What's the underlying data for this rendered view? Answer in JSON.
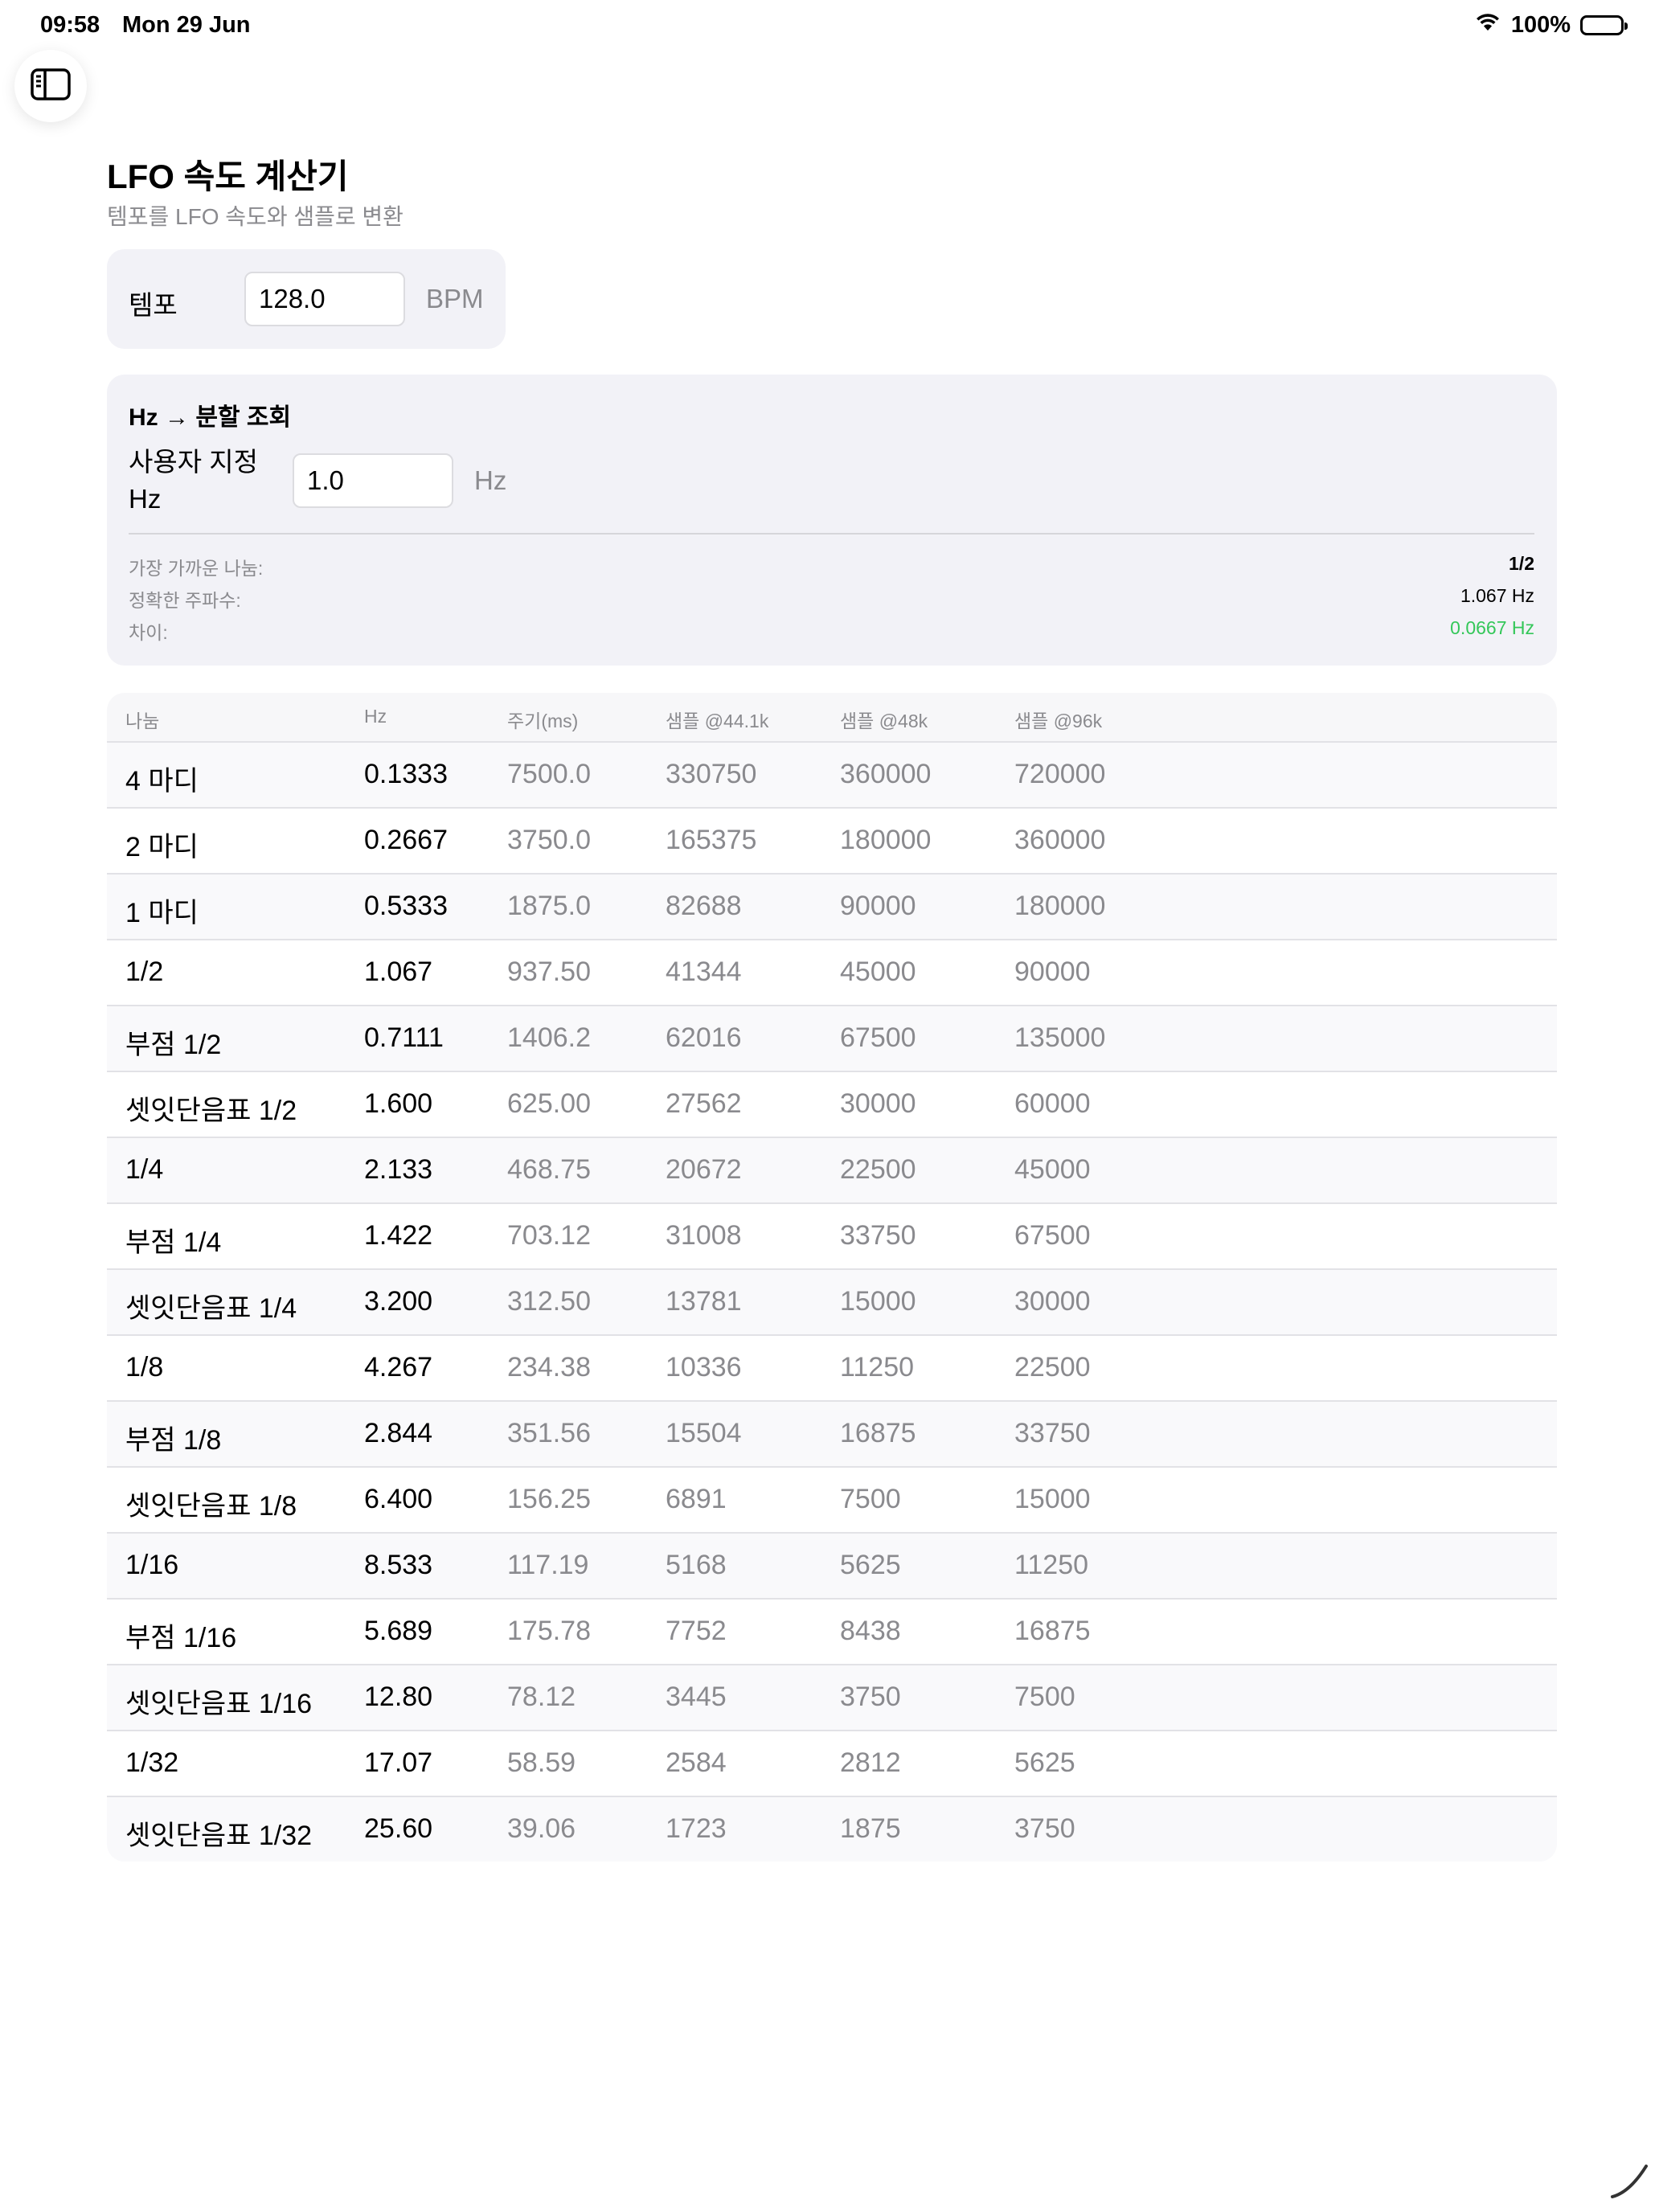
{
  "status": {
    "time": "09:58",
    "date": "Mon 29 Jun",
    "battery": "100%"
  },
  "colors": {
    "accent_green": "#34c759",
    "secondary_text": "#8a8a8e",
    "card_bg": "#f2f2f7"
  },
  "header": {
    "title": "LFO 속도 계산기",
    "subtitle": "템포를 LFO 속도와 샘플로 변환"
  },
  "tempo": {
    "label": "템포",
    "value": "128.0",
    "unit": "BPM"
  },
  "lookup": {
    "heading": "Hz → 분할 조회",
    "custom_label": "사용자 지정 Hz",
    "value": "1.0",
    "unit": "Hz",
    "nearest_label": "가장 가까운 나눔:",
    "nearest_value": "1/2",
    "exact_label": "정확한 주파수:",
    "exact_value": "1.067 Hz",
    "diff_label": "차이:",
    "diff_value": "0.0667 Hz"
  },
  "table": {
    "headers": [
      "나눔",
      "Hz",
      "주기(ms)",
      "샘플 @44.1k",
      "샘플 @48k",
      "샘플 @96k"
    ],
    "rows": [
      [
        "4 마디",
        "0.1333",
        "7500.0",
        "330750",
        "360000",
        "720000"
      ],
      [
        "2 마디",
        "0.2667",
        "3750.0",
        "165375",
        "180000",
        "360000"
      ],
      [
        "1 마디",
        "0.5333",
        "1875.0",
        "82688",
        "90000",
        "180000"
      ],
      [
        "1/2",
        "1.067",
        "937.50",
        "41344",
        "45000",
        "90000"
      ],
      [
        "부점 1/2",
        "0.7111",
        "1406.2",
        "62016",
        "67500",
        "135000"
      ],
      [
        "셋잇단음표 1/2",
        "1.600",
        "625.00",
        "27562",
        "30000",
        "60000"
      ],
      [
        "1/4",
        "2.133",
        "468.75",
        "20672",
        "22500",
        "45000"
      ],
      [
        "부점 1/4",
        "1.422",
        "703.12",
        "31008",
        "33750",
        "67500"
      ],
      [
        "셋잇단음표 1/4",
        "3.200",
        "312.50",
        "13781",
        "15000",
        "30000"
      ],
      [
        "1/8",
        "4.267",
        "234.38",
        "10336",
        "11250",
        "22500"
      ],
      [
        "부점 1/8",
        "2.844",
        "351.56",
        "15504",
        "16875",
        "33750"
      ],
      [
        "셋잇단음표 1/8",
        "6.400",
        "156.25",
        "6891",
        "7500",
        "15000"
      ],
      [
        "1/16",
        "8.533",
        "117.19",
        "5168",
        "5625",
        "11250"
      ],
      [
        "부점 1/16",
        "5.689",
        "175.78",
        "7752",
        "8438",
        "16875"
      ],
      [
        "셋잇단음표 1/16",
        "12.80",
        "78.12",
        "3445",
        "3750",
        "7500"
      ],
      [
        "1/32",
        "17.07",
        "58.59",
        "2584",
        "2812",
        "5625"
      ],
      [
        "셋잇단음표 1/32",
        "25.60",
        "39.06",
        "1723",
        "1875",
        "3750"
      ]
    ]
  }
}
